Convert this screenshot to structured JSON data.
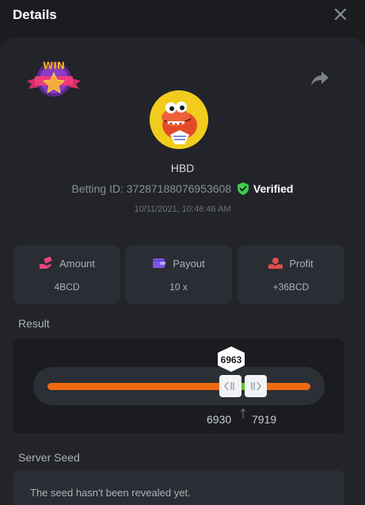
{
  "header": {
    "title": "Details",
    "close_icon": "close-icon"
  },
  "bet": {
    "username": "HBD",
    "betting_id_label": "Betting ID:",
    "betting_id": "37287188076953608",
    "verified_label": "Verified",
    "datetime": "10/11/2021, 10:46:46 AM",
    "badge_icon": "win-badge-icon",
    "avatar_icon": "crocodile-avatar-icon",
    "share_icon": "share-icon"
  },
  "stats": [
    {
      "label": "Amount",
      "value": "4BCD",
      "icon": "money-hand-icon",
      "icon_color": "#e8467a"
    },
    {
      "label": "Payout",
      "value": "10 x",
      "icon": "wallet-icon",
      "icon_color": "#7b56e6"
    },
    {
      "label": "Profit",
      "value": "+36BCD",
      "icon": "coin-hand-icon",
      "icon_color": "#e34b4b"
    }
  ],
  "result": {
    "section_label": "Result",
    "value": "6963",
    "range_low": "6930",
    "range_high": "7919",
    "slider_min": 0,
    "slider_max": 10000,
    "accent_color": "#ee6a12",
    "win_zone_color": "#55c62d"
  },
  "server_seed": {
    "section_label": "Server Seed",
    "message": "The seed hasn't been revealed yet."
  }
}
